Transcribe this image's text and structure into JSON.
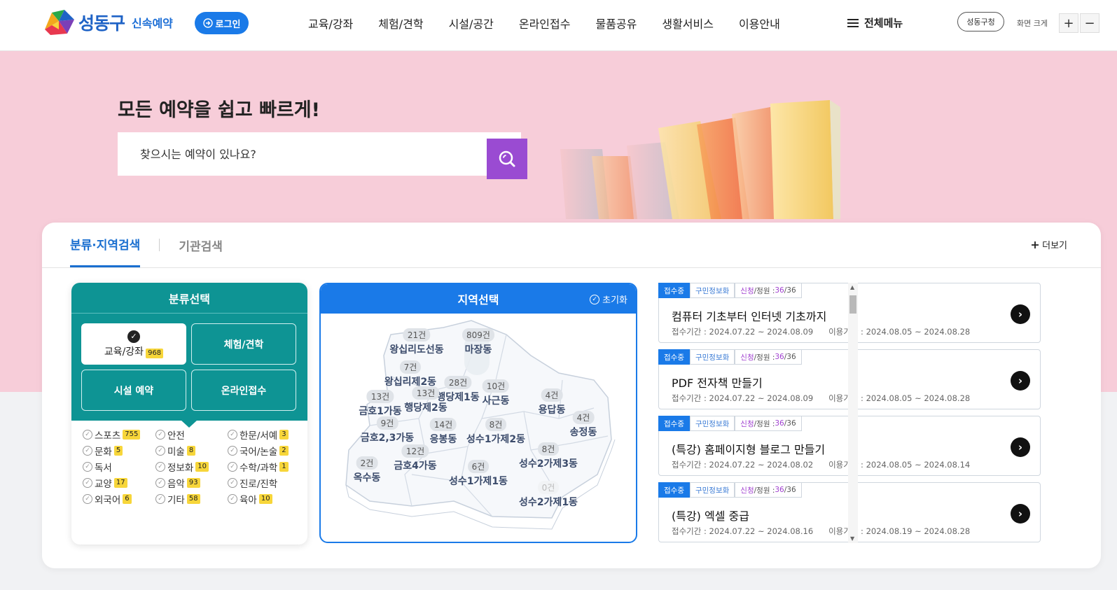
{
  "header": {
    "logo_text": "성동구",
    "logo_sub": "신속예약",
    "login_label": "로그인",
    "nav": [
      "교육/강좌",
      "체험/견학",
      "시설/공간",
      "온라인접수",
      "물품공유",
      "생활서비스",
      "이용안내"
    ],
    "menu_all": "전체메뉴",
    "office_label": "성동구청",
    "zoom_label": "화면 크게",
    "zoom_in": "+",
    "zoom_out": "−"
  },
  "hero": {
    "title": "모든 예약을 쉽고 빠르게!",
    "search_placeholder": "찾으시는 예약이 있나요?"
  },
  "tabs": {
    "active": "분류·지역검색",
    "inactive": "기관검색",
    "more": "더보기"
  },
  "category": {
    "title": "분류선택",
    "buttons": [
      {
        "label": "교육/강좌",
        "count": "968",
        "selected": true
      },
      {
        "label": "체험/견학"
      },
      {
        "label": "시설 예약"
      },
      {
        "label": "온라인접수"
      }
    ],
    "subs": [
      {
        "label": "스포츠",
        "count": "755"
      },
      {
        "label": "안전",
        "count": ""
      },
      {
        "label": "한문/서예",
        "count": "3"
      },
      {
        "label": "문화",
        "count": "5"
      },
      {
        "label": "미술",
        "count": "8"
      },
      {
        "label": "국어/논술",
        "count": "2"
      },
      {
        "label": "독서",
        "count": ""
      },
      {
        "label": "정보화",
        "count": "10"
      },
      {
        "label": "수학/과학",
        "count": "1"
      },
      {
        "label": "교양",
        "count": "17"
      },
      {
        "label": "음악",
        "count": "93"
      },
      {
        "label": "진로/진학",
        "count": ""
      },
      {
        "label": "외국어",
        "count": "6"
      },
      {
        "label": "기타",
        "count": "58"
      },
      {
        "label": "육아",
        "count": "10"
      }
    ]
  },
  "region": {
    "title": "지역선택",
    "reset": "초기화",
    "areas": [
      {
        "name": "왕십리도선동",
        "count": "21건"
      },
      {
        "name": "마장동",
        "count": "809건"
      },
      {
        "name": "왕십리제2동",
        "count": "7건"
      },
      {
        "name": "행당제1동",
        "count": "28건"
      },
      {
        "name": "사근동",
        "count": "10건"
      },
      {
        "name": "용답동",
        "count": "4건"
      },
      {
        "name": "금호1가동",
        "count": "13건"
      },
      {
        "name": "행당제2동",
        "count": "13건"
      },
      {
        "name": "금호2,3가동",
        "count": "9건"
      },
      {
        "name": "응봉동",
        "count": "14건"
      },
      {
        "name": "성수1가제2동",
        "count": "8건"
      },
      {
        "name": "송정동",
        "count": "4건"
      },
      {
        "name": "금호4가동",
        "count": "12건"
      },
      {
        "name": "성수2가제3동",
        "count": "8건"
      },
      {
        "name": "옥수동",
        "count": "2건"
      },
      {
        "name": "성수1가제1동",
        "count": "6건"
      },
      {
        "name": "성수2가제1동",
        "count": "0건"
      }
    ]
  },
  "programs": [
    {
      "status": "접수중",
      "category": "구민정보화",
      "quota_label": "신청",
      "quota_sep": "/정원 : ",
      "applied": "36",
      "capacity": "/36",
      "title": "컴퓨터 기초부터 인터넷 기초까지",
      "dates": "접수기간 : 2024.07.22 ~ 2024.08.09      이용기간 : 2024.08.05 ~ 2024.08.28"
    },
    {
      "status": "접수중",
      "category": "구민정보화",
      "quota_label": "신청",
      "quota_sep": "/정원 : ",
      "applied": "36",
      "capacity": "/36",
      "title": "PDF 전자책 만들기",
      "dates": "접수기간 : 2024.07.22 ~ 2024.08.09      이용기간 : 2024.08.05 ~ 2024.08.28"
    },
    {
      "status": "접수중",
      "category": "구민정보화",
      "quota_label": "신청",
      "quota_sep": "/정원 : ",
      "applied": "36",
      "capacity": "/36",
      "title": "(특강)  홈페이지형 블로그 만들기",
      "dates": "접수기간 : 2024.07.22 ~ 2024.08.02      이용기간 : 2024.08.05 ~ 2024.08.14"
    },
    {
      "status": "접수중",
      "category": "구민정보화",
      "quota_label": "신청",
      "quota_sep": "/정원 : ",
      "applied": "36",
      "capacity": "/36",
      "title": "(특강)  엑셀 중급",
      "dates": "접수기간 : 2024.07.22 ~ 2024.08.16      이용기간 : 2024.08.19 ~ 2024.08.28"
    }
  ],
  "colors": {
    "primary": "#1a7ae8",
    "teal": "#0e9494",
    "hero_bg": "#f7cdd9",
    "search_btn": "#9a4bd2",
    "badge": "#f7d63a"
  }
}
